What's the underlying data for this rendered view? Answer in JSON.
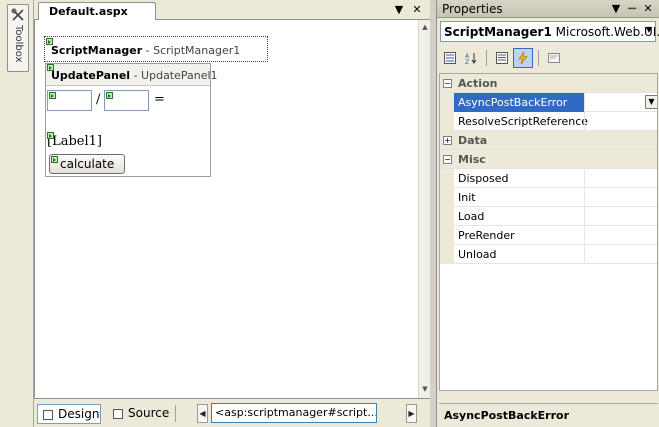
{
  "toolbox": {
    "label": "Toolbox"
  },
  "document": {
    "tab_title": "Default.aspx",
    "scriptmanager": {
      "type": "ScriptManager",
      "separator": " - ",
      "id": "ScriptManager1"
    },
    "updatepanel": {
      "type": "UpdatePanel",
      "separator": " - ",
      "id": "UpdatePanel1"
    },
    "divide_symbol": "/",
    "equals_symbol": "=",
    "label_text": "[Label1]",
    "button_label": "calculate",
    "views": {
      "design": "Design",
      "source": "Source"
    },
    "breadcrumb": "<asp:scriptmanager#script...>"
  },
  "properties": {
    "title": "Properties",
    "object_name": "ScriptManager1",
    "object_type": "Microsoft.Web.UI.Sc",
    "rows": [
      {
        "kind": "category",
        "label": "Action",
        "toggle": "−"
      },
      {
        "kind": "property",
        "name": "AsyncPostBackError",
        "selected": true
      },
      {
        "kind": "property",
        "name": "ResolveScriptReference"
      },
      {
        "kind": "category",
        "label": "Data",
        "toggle": "+"
      },
      {
        "kind": "category",
        "label": "Misc",
        "toggle": "−"
      },
      {
        "kind": "property",
        "name": "Disposed"
      },
      {
        "kind": "property",
        "name": "Init"
      },
      {
        "kind": "property",
        "name": "Load"
      },
      {
        "kind": "property",
        "name": "PreRender"
      },
      {
        "kind": "property",
        "name": "Unload"
      }
    ],
    "description": "AsyncPostBackError"
  },
  "colors": {
    "selection": "#316ac5",
    "chrome": "#ece9d8"
  }
}
